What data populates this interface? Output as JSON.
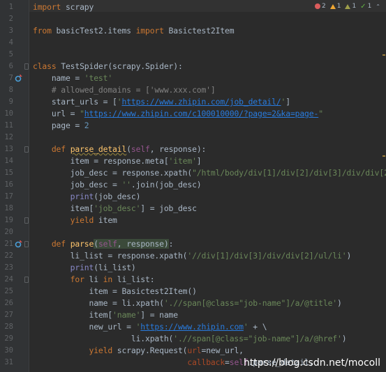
{
  "inspection": {
    "errors": "2",
    "warnings": "1",
    "weak_warnings": "1",
    "ok": "1"
  },
  "watermark": "https://blog.csdn.net/mocoll",
  "colors": {
    "background": "#2b2b2b",
    "keyword": "#cc7832",
    "string": "#6a8759",
    "number": "#6897bb",
    "function": "#ffc66d",
    "self": "#94558d"
  },
  "lines": [
    {
      "n": "1",
      "t": [
        [
          "kw",
          "import"
        ],
        [
          "p",
          " scrapy"
        ]
      ]
    },
    {
      "n": "2",
      "t": []
    },
    {
      "n": "3",
      "t": [
        [
          "kw",
          "from"
        ],
        [
          "p",
          " basicTest2.items "
        ],
        [
          "kw",
          "import"
        ],
        [
          "p",
          " Basictest2Item"
        ]
      ]
    },
    {
      "n": "4",
      "t": []
    },
    {
      "n": "5",
      "t": []
    },
    {
      "n": "6",
      "t": [
        [
          "kw",
          "class"
        ],
        [
          "p",
          " TestSpider(scrapy.Spider):"
        ]
      ]
    },
    {
      "n": "7",
      "t": [
        [
          "p",
          "    name = "
        ],
        [
          "str",
          "'test'"
        ]
      ]
    },
    {
      "n": "8",
      "t": [
        [
          "cmt",
          "    # allowed_domains = ['www.xxx.com']"
        ]
      ]
    },
    {
      "n": "9",
      "t": [
        [
          "p",
          "    start_urls = ["
        ],
        [
          "str",
          "'"
        ],
        [
          "link",
          "https://www.zhipin.com/job_detail/"
        ],
        [
          "str",
          "'"
        ],
        [
          "p",
          "]"
        ]
      ]
    },
    {
      "n": "10",
      "t": [
        [
          "p",
          "    url = "
        ],
        [
          "str",
          "\""
        ],
        [
          "link",
          "https://www.zhipin.com/c100010000/?page=2&ka=page-"
        ],
        [
          "str",
          "\""
        ]
      ]
    },
    {
      "n": "11",
      "t": [
        [
          "p",
          "    page = "
        ],
        [
          "num",
          "2"
        ]
      ]
    },
    {
      "n": "12",
      "t": []
    },
    {
      "n": "13",
      "t": [
        [
          "p",
          "    "
        ],
        [
          "kw",
          "def"
        ],
        [
          "p",
          " "
        ],
        [
          "fnw",
          "parse_detail"
        ],
        [
          "p",
          "("
        ],
        [
          "self",
          "self"
        ],
        [
          "p",
          ", response):"
        ]
      ]
    },
    {
      "n": "14",
      "t": [
        [
          "p",
          "        item = response.meta["
        ],
        [
          "str",
          "'item'"
        ],
        [
          "p",
          "]"
        ]
      ]
    },
    {
      "n": "15",
      "t": [
        [
          "p",
          "        job_desc = response.xpath("
        ],
        [
          "str",
          "\"/html/body/div[1]/div[2]/div[3]/div/div[2"
        ]
      ]
    },
    {
      "n": "16",
      "t": [
        [
          "p",
          "        job_desc = "
        ],
        [
          "str",
          "''"
        ],
        [
          "p",
          ".join(job_desc)"
        ]
      ]
    },
    {
      "n": "17",
      "t": [
        [
          "p",
          "        "
        ],
        [
          "fnc",
          "print"
        ],
        [
          "p",
          "(job_desc)"
        ]
      ]
    },
    {
      "n": "18",
      "t": [
        [
          "p",
          "        item["
        ],
        [
          "str",
          "'job_desc'"
        ],
        [
          "p",
          "] = job_desc"
        ]
      ]
    },
    {
      "n": "19",
      "t": [
        [
          "p",
          "        "
        ],
        [
          "kw",
          "yield"
        ],
        [
          "p",
          " item"
        ]
      ]
    },
    {
      "n": "20",
      "t": []
    },
    {
      "n": "21",
      "t": [
        [
          "p",
          "    "
        ],
        [
          "kw",
          "def"
        ],
        [
          "p",
          " "
        ],
        [
          "fn",
          "parse"
        ],
        [
          "hl",
          "("
        ],
        [
          "hlself",
          "self"
        ],
        [
          "hl",
          ", response)"
        ],
        [
          "p",
          ":"
        ]
      ]
    },
    {
      "n": "22",
      "t": [
        [
          "p",
          "        li_list = response.xpath("
        ],
        [
          "str",
          "'//div[1]/div[3]/div/div[2]/ul/li'"
        ],
        [
          "p",
          ")"
        ]
      ]
    },
    {
      "n": "23",
      "t": [
        [
          "p",
          "        "
        ],
        [
          "fnc",
          "print"
        ],
        [
          "p",
          "(li_list)"
        ]
      ]
    },
    {
      "n": "24",
      "t": [
        [
          "p",
          "        "
        ],
        [
          "kw",
          "for"
        ],
        [
          "p",
          " li "
        ],
        [
          "kw",
          "in"
        ],
        [
          "p",
          " li_list:"
        ]
      ]
    },
    {
      "n": "25",
      "t": [
        [
          "p",
          "            item = Basictest2Item()"
        ]
      ]
    },
    {
      "n": "26",
      "t": [
        [
          "p",
          "            name = li.xpath("
        ],
        [
          "str",
          "'.//span[@class=\"job-name\"]/a/@title'"
        ],
        [
          "p",
          ")"
        ]
      ]
    },
    {
      "n": "27",
      "t": [
        [
          "p",
          "            item["
        ],
        [
          "str",
          "'name'"
        ],
        [
          "p",
          "] = name"
        ]
      ]
    },
    {
      "n": "28",
      "t": [
        [
          "p",
          "            new_url = "
        ],
        [
          "str",
          "'"
        ],
        [
          "link",
          "https://www.zhipin.com"
        ],
        [
          "str",
          "'"
        ],
        [
          "p",
          " + \\"
        ]
      ]
    },
    {
      "n": "29",
      "t": [
        [
          "p",
          "                     li.xpath("
        ],
        [
          "str",
          "'.//span[@class=\"job-name\"]/a/@href'"
        ],
        [
          "p",
          ")"
        ]
      ]
    },
    {
      "n": "30",
      "t": [
        [
          "p",
          "            "
        ],
        [
          "kw",
          "yield"
        ],
        [
          "p",
          " scrapy.Request("
        ],
        [
          "named",
          "url"
        ],
        [
          "p",
          "=new_url,"
        ]
      ]
    },
    {
      "n": "31",
      "t": [
        [
          "p",
          "                                 "
        ],
        [
          "named",
          "callback"
        ],
        [
          "p",
          "="
        ],
        [
          "self",
          "self"
        ],
        [
          "p",
          ".parse_detail,"
        ]
      ]
    }
  ]
}
